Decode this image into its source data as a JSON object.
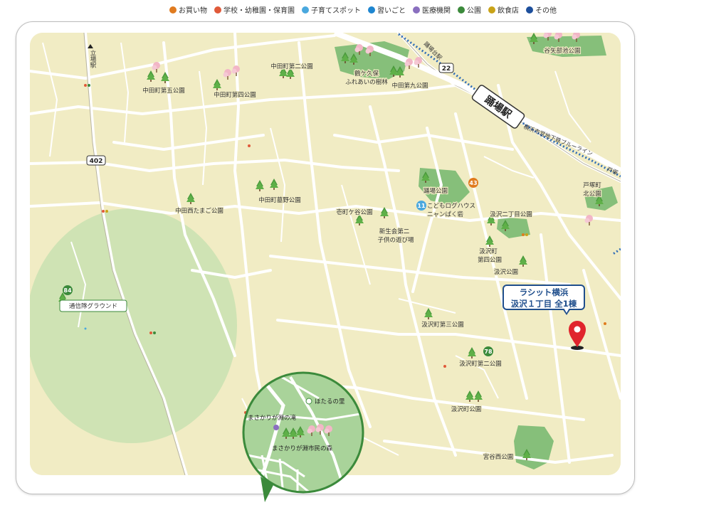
{
  "legend": [
    {
      "label": "お買い物",
      "color": "#e07b1f"
    },
    {
      "label": "学校・幼稚園・保育園",
      "color": "#e05a3a"
    },
    {
      "label": "子育てスポット",
      "color": "#4aa8de"
    },
    {
      "label": "習いごと",
      "color": "#1e86d0"
    },
    {
      "label": "医療機関",
      "color": "#8a6fbf"
    },
    {
      "label": "公園",
      "color": "#3b8a3b"
    },
    {
      "label": "飲食店",
      "color": "#c9a318"
    },
    {
      "label": "その他",
      "color": "#1d4f9c"
    }
  ],
  "map": {
    "station_main": "踊場駅",
    "station_tachiba": "立場駅",
    "route_402": "402",
    "route_22": "22",
    "subway_line": "横浜市営地下鉄ブルーライン",
    "subway_line_totsuka": "戸塚",
    "station_odoriba_small": "踊場台駅",
    "places": {
      "yadobe_pond_park": "谷矢部池公園",
      "nakata_2_park": "中田町第二公園",
      "tsurugakubo_1": "鶴ケ久保",
      "tsurugakubo_2": "ふれあいの樹林",
      "nakata_9_park": "中田第九公園",
      "nakata_5_park": "中田町第五公園",
      "nakata_4_park": "中田町第四公園",
      "nakata_bono_park": "中田町墓野公園",
      "nakata_nishi_park": "中田西たまご公園",
      "odoriba_park": "踊場公園",
      "kodomo_log_1": "こどもログハウス",
      "kodomo_log_2": "ニャンぱく砦",
      "ichimachigaya_park": "壱町ケ谷公園",
      "shinsei_1": "新生会第二",
      "shinsei_2": "子供の遊び場",
      "gumisawa_2chome_park": "汲沢二丁目公園",
      "totsuka_kita_1": "戸塚町",
      "totsuka_kita_2": "北公園",
      "gumisawa_4_1": "汲沢町",
      "gumisawa_4_2": "第四公園",
      "gumisawa_park": "汲沢公園",
      "gumisawa_3_park": "汲沢町第三公園",
      "gumisawa_2_park": "汲沢町第二公園",
      "gumisawa_town_park": "汲沢町公園",
      "miyayanishi_park": "宮谷西公園",
      "tsushintai_ground": "通信隊グラウンド"
    },
    "badges": {
      "b84": "84",
      "b43": "43",
      "b11": "11",
      "b78": "78"
    },
    "inset": {
      "hotaru": "ほたるの里",
      "masakari_falls": "まさかりが淵の滝",
      "masakari_forest": "まさかりが淵市民の森"
    },
    "callout": {
      "line1": "ラシット横浜",
      "line2": "汲沢１丁目 全1棟"
    }
  }
}
